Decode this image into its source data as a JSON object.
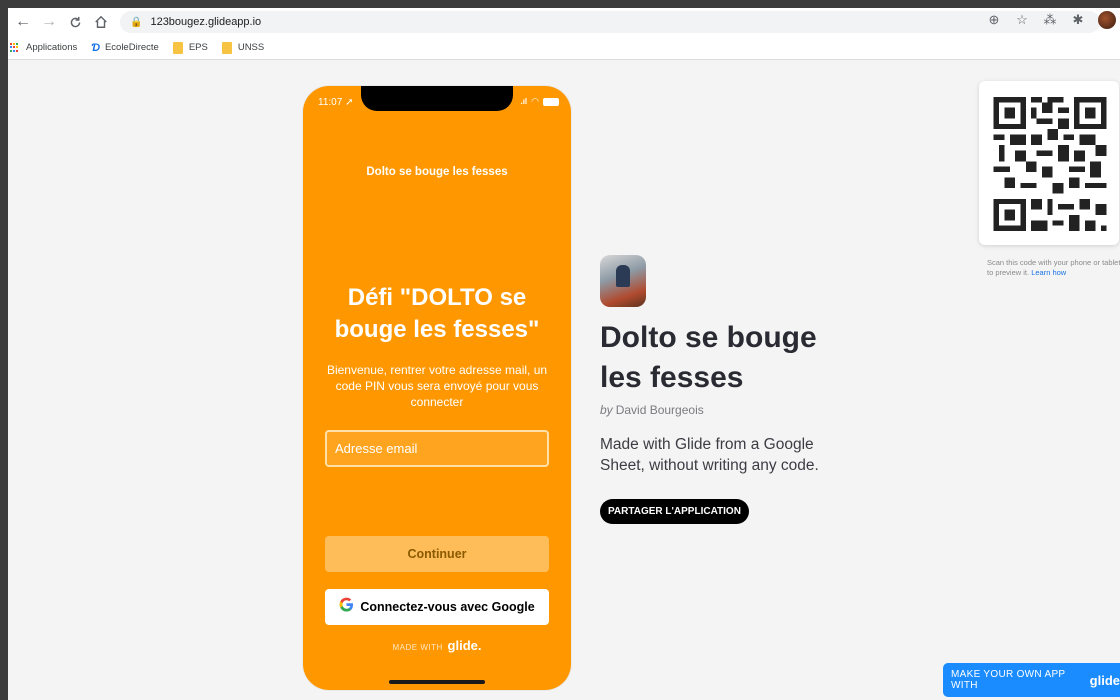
{
  "browser": {
    "url": "123bougez.glideapp.io",
    "bookmarks": [
      {
        "label": "Applications",
        "icon": "apps-grid-icon"
      },
      {
        "label": "EcoleDirecte",
        "icon": "ecoledirecte-icon"
      },
      {
        "label": "EPS",
        "icon": "folder-icon"
      },
      {
        "label": "UNSS",
        "icon": "folder-icon"
      }
    ]
  },
  "phone": {
    "time": "11:07",
    "header": "Dolto se bouge les fesses",
    "title": "Défi \"DOLTO se bouge les fesses\"",
    "description": "Bienvenue, rentrer votre adresse mail, un code PIN vous sera envoyé pour vous connecter",
    "email_placeholder": "Adresse email",
    "continue_label": "Continuer",
    "google_label": "Connectez-vous avec Google",
    "made_with": "MADE WITH",
    "brand": "glide."
  },
  "app": {
    "title": "Dolto se bouge les fesses",
    "by": "by",
    "author": "David Bourgeois",
    "description": "Made with Glide from a Google Sheet, without writing any code.",
    "share_label": "PARTAGER L'APPLICATION"
  },
  "qr": {
    "caption": "Scan this code with your phone or tablet to preview it.",
    "learn_label": "Learn how"
  },
  "make_app": {
    "label": "MAKE YOUR OWN APP WITH",
    "brand": "glide"
  },
  "colors": {
    "primary": "#ff9800",
    "accent": "#1a8cff",
    "text_dark": "#2a2a33"
  }
}
